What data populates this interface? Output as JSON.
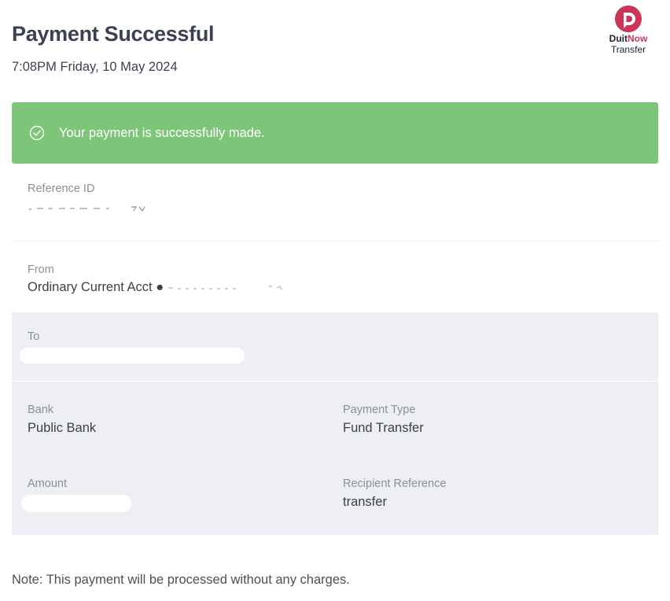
{
  "header": {
    "title": "Payment Successful",
    "timestamp": "7:08PM Friday, 10 May 2024"
  },
  "brand": {
    "name_part1": "Duit",
    "name_part2": "Now",
    "subtitle": "Transfer",
    "icon": "duitnow-logo-icon",
    "accent_color": "#c8365a"
  },
  "banner": {
    "icon": "check-circle-icon",
    "message": "Your payment is successfully made.",
    "color": "#7dc579"
  },
  "reference": {
    "label": "Reference ID"
  },
  "from": {
    "label": "From",
    "value": "Ordinary Current Acct ●"
  },
  "to": {
    "label": "To"
  },
  "details": {
    "bank_label": "Bank",
    "bank_value": "Public Bank",
    "payment_type_label": "Payment Type",
    "payment_type_value": "Fund Transfer",
    "amount_label": "Amount",
    "recipient_ref_label": "Recipient Reference",
    "recipient_ref_value": "transfer"
  },
  "note": "Note: This payment will be processed without any charges."
}
